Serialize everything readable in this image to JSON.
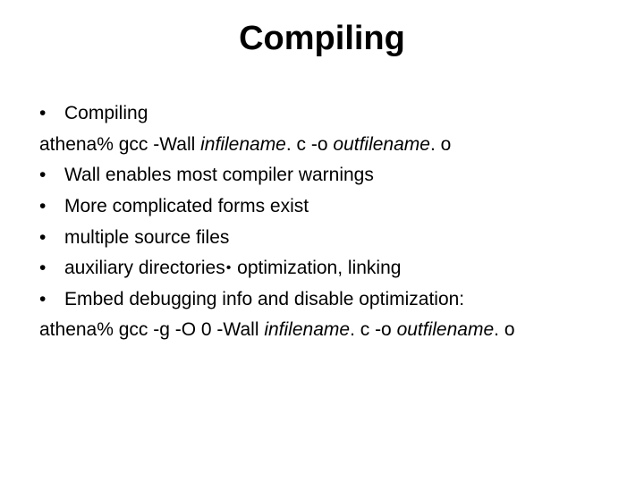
{
  "title": "Compiling",
  "lines": {
    "b1": "Compiling",
    "cmd1_prefix": "athena% gcc -Wall ",
    "cmd1_in": "infilename",
    "cmd1_mid": ". c -o ",
    "cmd1_out": "outfilename",
    "cmd1_suffix": ". o",
    "b2": "Wall enables most compiler warnings",
    "b3": "More complicated forms exist",
    "b4": "multiple source files",
    "b5a": "auxiliary directories",
    "b5b": " optimization, linking",
    "b6": "Embed debugging info and disable optimization:",
    "cmd2_prefix": "athena% gcc -g -O 0 -Wall ",
    "cmd2_in": "infilename",
    "cmd2_mid": ". c -o ",
    "cmd2_out": "outfilename",
    "cmd2_suffix": ". o"
  },
  "glyphs": {
    "bullet": "•"
  }
}
